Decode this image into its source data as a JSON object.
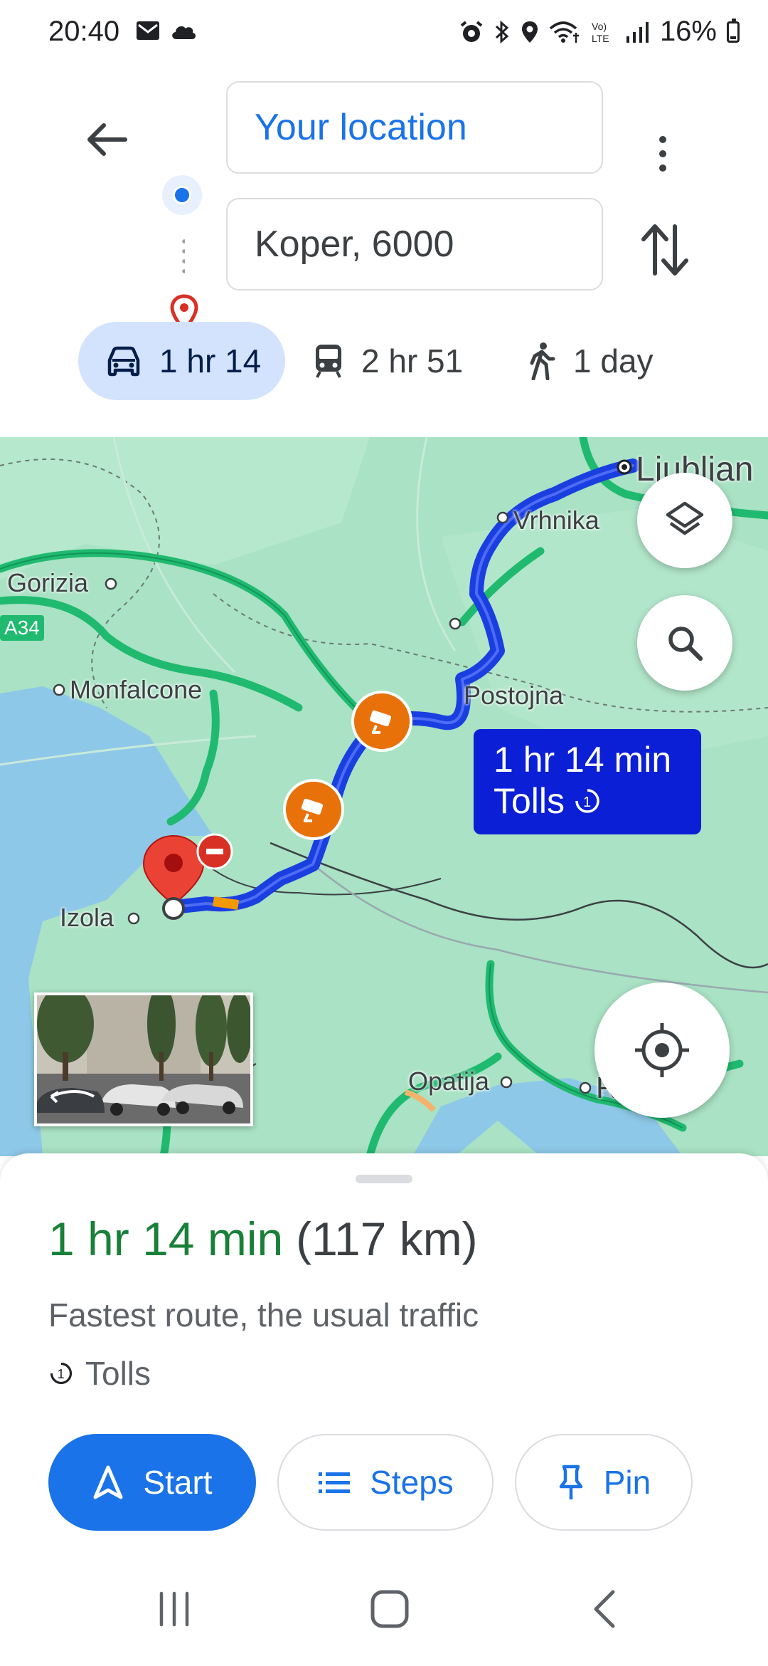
{
  "status_bar": {
    "time": "20:40",
    "battery_text": "16%",
    "left_icons": [
      "mail-icon",
      "cloud-icon"
    ],
    "right_icons": [
      "alarm-icon",
      "bluetooth-icon",
      "location-icon",
      "wifi-call-icon",
      "volte-icon",
      "signal-icon",
      "battery-icon"
    ],
    "volte_label": "Vo)\nLTE"
  },
  "header": {
    "origin": "Your location",
    "destination": "Koper, 6000",
    "modes": [
      {
        "icon": "car-icon",
        "label": "1 hr 14",
        "active": true
      },
      {
        "icon": "train-icon",
        "label": "2 hr 51",
        "active": false
      },
      {
        "icon": "walk-icon",
        "label": "1 day",
        "active": false
      }
    ]
  },
  "map": {
    "labels": {
      "gorizia": "Gorizia",
      "a34": "A34",
      "monfalcone": "Monfalcone",
      "vrhnika": "Vrhnika",
      "postojna": "Postojna",
      "izola": "Izola",
      "opatija": "Opatija",
      "ljubljana_partial": "Ljubljan",
      "rijeka_partial": "Rij"
    },
    "route_tooltip": {
      "duration": "1 hr 14 min",
      "tolls": "Tolls"
    }
  },
  "sheet": {
    "duration": "1 hr 14 min",
    "distance": "(117 km)",
    "description": "Fastest route, the usual traffic",
    "tolls": "Tolls",
    "buttons": {
      "start": "Start",
      "steps": "Steps",
      "pin": "Pin"
    }
  },
  "colors": {
    "accent": "#1a73e8",
    "route": "#1a3fe0",
    "tooltip": "#0b1fd6",
    "duration_green": "#188038",
    "map_land": "#a8e0c2",
    "sea": "#8ec8e8",
    "highway": "#1fba6f"
  }
}
